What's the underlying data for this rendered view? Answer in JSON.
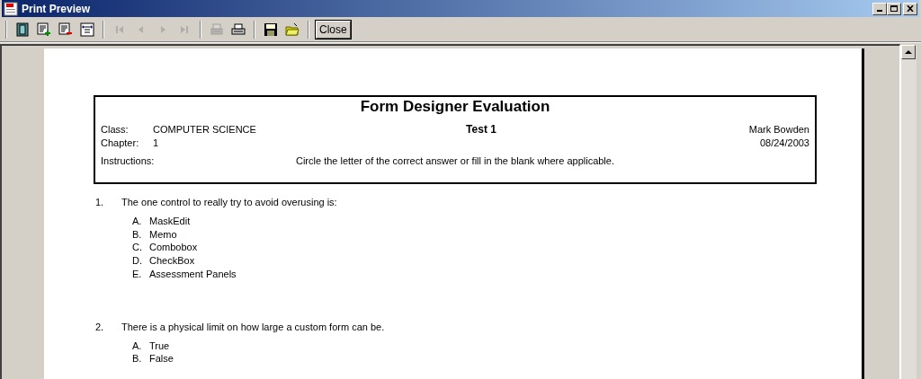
{
  "window": {
    "title": "Print Preview"
  },
  "toolbar": [
    {
      "kind": "icon",
      "disabled": false
    },
    {
      "kind": "icon",
      "disabled": false
    },
    {
      "kind": "icon",
      "disabled": false
    },
    {
      "kind": "icon",
      "disabled": false
    },
    {
      "kind": "separator"
    },
    {
      "kind": "icon",
      "disabled": true
    },
    {
      "kind": "icon",
      "disabled": true
    },
    {
      "kind": "icon",
      "disabled": true
    },
    {
      "kind": "icon",
      "disabled": true
    },
    {
      "kind": "separator"
    },
    {
      "kind": "icon",
      "disabled": true
    },
    {
      "kind": "icon",
      "disabled": false
    },
    {
      "kind": "separator"
    },
    {
      "kind": "icon",
      "disabled": false
    },
    {
      "kind": "icon",
      "disabled": false
    },
    {
      "kind": "separator"
    },
    {
      "kind": "button",
      "label": "Close"
    }
  ],
  "document": {
    "header": {
      "title": "Form Designer Evaluation",
      "class_label": "Class:",
      "class_value": "COMPUTER SCIENCE",
      "test": "Test 1",
      "author": "Mark Bowden",
      "chapter_label": "Chapter:",
      "chapter_value": "1",
      "date": "08/24/2003",
      "instructions_label": "Instructions:",
      "instructions": "Circle the letter of the correct answer or fill in the blank where applicable."
    },
    "questions": [
      {
        "number": "1.",
        "text": "The one control to really try to avoid overusing is:",
        "options": [
          {
            "letter": "A.",
            "text": "MaskEdit"
          },
          {
            "letter": "B.",
            "text": "Memo"
          },
          {
            "letter": "C.",
            "text": "Combobox"
          },
          {
            "letter": "D.",
            "text": "CheckBox"
          },
          {
            "letter": "E.",
            "text": "Assessment Panels"
          }
        ]
      },
      {
        "number": "2.",
        "text": "There is a physical limit on how large a custom form can be.",
        "options": [
          {
            "letter": "A.",
            "text": "True"
          },
          {
            "letter": "B.",
            "text": "False"
          }
        ]
      }
    ]
  }
}
